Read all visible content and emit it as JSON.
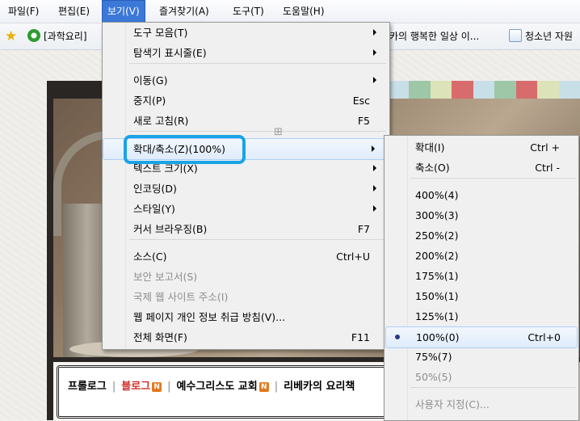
{
  "menubar": {
    "items": [
      {
        "label": "파일(F)"
      },
      {
        "label": "편집(E)"
      },
      {
        "label": "보기(V)"
      },
      {
        "label": "즐겨찾기(A)"
      },
      {
        "label": "도구(T)"
      },
      {
        "label": "도움말(H)"
      }
    ]
  },
  "favorites": {
    "items": [
      {
        "label": "[과학요리]"
      },
      {
        "label": "카의 행복한 일상 이..."
      },
      {
        "label": "청소년 자원"
      }
    ]
  },
  "view_menu": {
    "items": [
      {
        "label": "도구 모음(T)",
        "shortcut": "",
        "submenu": true,
        "disabled": false
      },
      {
        "label": "탐색기 표시줄(E)",
        "shortcut": "",
        "submenu": true,
        "disabled": false
      },
      {
        "label": "이동(G)",
        "shortcut": "",
        "submenu": true,
        "disabled": false
      },
      {
        "label": "중지(P)",
        "shortcut": "Esc",
        "submenu": false,
        "disabled": false
      },
      {
        "label": "새로 고침(R)",
        "shortcut": "F5",
        "submenu": false,
        "disabled": false
      },
      {
        "label": "확대/축소(Z)(100%)",
        "shortcut": "",
        "submenu": true,
        "disabled": false
      },
      {
        "label": "텍스트 크기(X)",
        "shortcut": "",
        "submenu": true,
        "disabled": false
      },
      {
        "label": "인코딩(D)",
        "shortcut": "",
        "submenu": true,
        "disabled": false
      },
      {
        "label": "스타일(Y)",
        "shortcut": "",
        "submenu": true,
        "disabled": false
      },
      {
        "label": "커서 브라우징(B)",
        "shortcut": "F7",
        "submenu": false,
        "disabled": false
      },
      {
        "label": "소스(C)",
        "shortcut": "Ctrl+U",
        "submenu": false,
        "disabled": false
      },
      {
        "label": "보안 보고서(S)",
        "shortcut": "",
        "submenu": false,
        "disabled": true
      },
      {
        "label": "국제 웹 사이트 주소(I)",
        "shortcut": "",
        "submenu": false,
        "disabled": true
      },
      {
        "label": "웹 페이지 개인 정보 취급 방침(V)...",
        "shortcut": "",
        "submenu": false,
        "disabled": false
      },
      {
        "label": "전체 화면(F)",
        "shortcut": "F11",
        "submenu": false,
        "disabled": false
      }
    ]
  },
  "zoom_menu": {
    "items": [
      {
        "label": "확대(I)",
        "shortcut": "Ctrl +",
        "disabled": false,
        "selected": false
      },
      {
        "label": "축소(O)",
        "shortcut": "Ctrl -",
        "disabled": false,
        "selected": false
      },
      {
        "label": "400%(4)",
        "shortcut": "",
        "disabled": false,
        "selected": false
      },
      {
        "label": "300%(3)",
        "shortcut": "",
        "disabled": false,
        "selected": false
      },
      {
        "label": "250%(2)",
        "shortcut": "",
        "disabled": false,
        "selected": false
      },
      {
        "label": "200%(2)",
        "shortcut": "",
        "disabled": false,
        "selected": false
      },
      {
        "label": "175%(1)",
        "shortcut": "",
        "disabled": false,
        "selected": false
      },
      {
        "label": "150%(1)",
        "shortcut": "",
        "disabled": false,
        "selected": false
      },
      {
        "label": "125%(1)",
        "shortcut": "",
        "disabled": false,
        "selected": false
      },
      {
        "label": "100%(0)",
        "shortcut": "Ctrl+0",
        "disabled": false,
        "selected": true
      },
      {
        "label": "75%(7)",
        "shortcut": "",
        "disabled": false,
        "selected": false
      },
      {
        "label": "50%(5)",
        "shortcut": "",
        "disabled": true,
        "selected": false
      },
      {
        "label": "사용자 지정(C)...",
        "shortcut": "",
        "disabled": true,
        "selected": false
      }
    ]
  },
  "blog_nav": {
    "items": [
      {
        "label": "프롤로그"
      },
      {
        "label": "블로그"
      },
      {
        "label": "예수그리스도 교회"
      },
      {
        "label": "리베카의 요리책"
      }
    ],
    "badge": "N"
  },
  "colors": {
    "menu_active": "#3b78d8",
    "highlight_ring": "#1aa3e6",
    "blog_link": "#d0302a",
    "new_badge": "#e07a1f"
  }
}
